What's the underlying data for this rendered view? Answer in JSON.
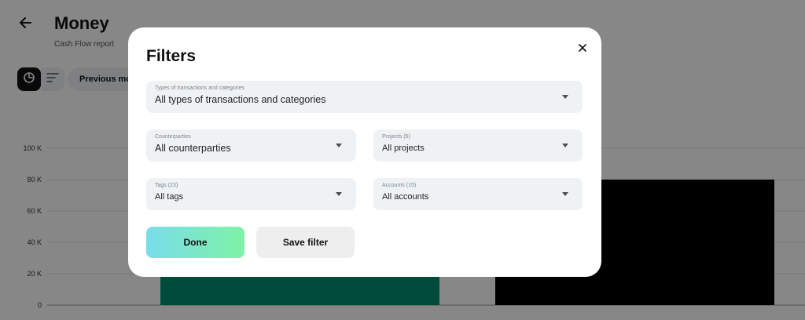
{
  "header": {
    "title": "Money",
    "subtitle": "Cash Flow report",
    "period_label": "Previous month"
  },
  "chart_data": {
    "type": "bar",
    "categories": [
      "",
      ""
    ],
    "values": [
      18000,
      80000
    ],
    "ylim": [
      0,
      100000
    ],
    "yticks": [
      "0",
      "20 K",
      "40 K",
      "60 K",
      "80 K",
      "100 K"
    ],
    "colors": [
      "#008e6d",
      "#000000"
    ],
    "grid": true
  },
  "modal": {
    "title": "Filters",
    "fields": {
      "types": {
        "label": "Types of transactions and categories",
        "value": "All types of transactions and categories"
      },
      "counterparties": {
        "label": "Counterparties",
        "value": "All counterparties"
      },
      "projects": {
        "label": "Projects (5)",
        "value": "All projects"
      },
      "tags": {
        "label": "Tags (23)",
        "value": "All tags"
      },
      "accounts": {
        "label": "Accounts (15)",
        "value": "All accounts"
      }
    },
    "done_label": "Done",
    "save_label": "Save filter"
  },
  "icons": {
    "back": "arrow-left-icon",
    "chart_view": "pie-chart-icon",
    "list_view": "filter-list-icon",
    "close": "close-icon",
    "dropdown": "caret-down-icon"
  },
  "colors": {
    "overlay": "#000000",
    "done_gradient_start": "#79ddea",
    "done_gradient_end": "#7ef2a6",
    "field_background": "#eef2f5"
  }
}
